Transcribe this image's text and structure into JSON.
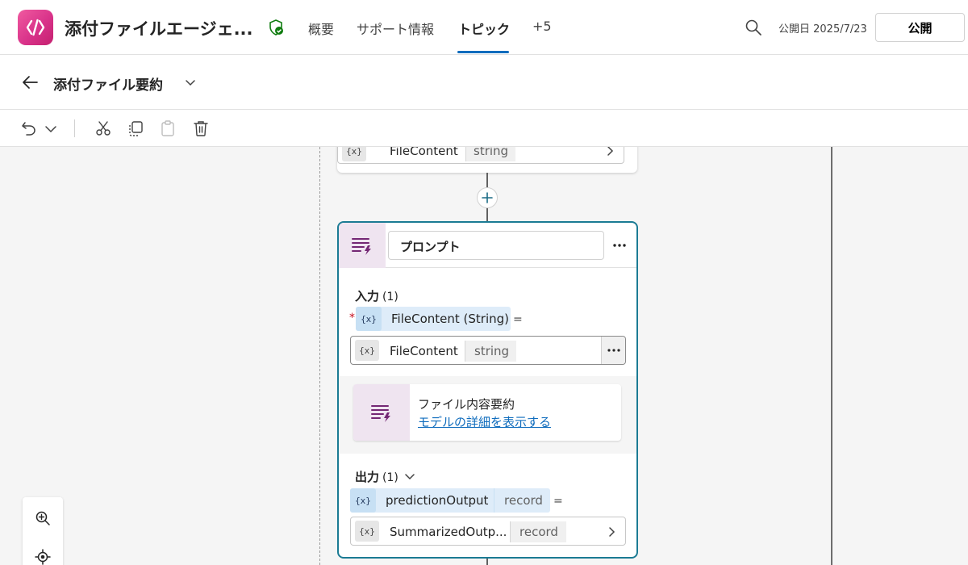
{
  "app": {
    "title": "添付ファイルエージェ...",
    "logo_icon": "code-app-icon",
    "status_icon": "shield-check-icon",
    "accent_color": "#0f6cbd",
    "logo_color": "#d9338a"
  },
  "nav": {
    "tabs": [
      {
        "label": "概要",
        "active": false
      },
      {
        "label": "サポート情報",
        "active": false
      },
      {
        "label": "トピック",
        "active": true
      },
      {
        "label": "+5",
        "active": false
      }
    ]
  },
  "header": {
    "published_date": "公開日 2025/7/23",
    "publish_label": "公開"
  },
  "topic": {
    "title": "添付ファイル要約"
  },
  "toolbar": {
    "icons": [
      "undo-icon",
      "chevron-down-icon",
      "cut-icon",
      "copy-icon",
      "paste-icon",
      "delete-icon"
    ]
  },
  "canvas": {
    "previous_node": {
      "var_icon": "{x}",
      "var_name": "FileContent",
      "var_type": "string"
    },
    "prompt_node": {
      "name": "プロンプト",
      "input_section": {
        "label": "入力",
        "count": "(1)"
      },
      "required_mark": "*",
      "input_param": {
        "icon": "{x}",
        "label": "FileContent (String)",
        "equals": "="
      },
      "input_value": {
        "icon": "{x}",
        "name": "FileContent",
        "type": "string"
      },
      "model": {
        "name": "ファイル内容要約",
        "link": "モデルの詳細を表示する"
      },
      "output_section": {
        "label": "出力",
        "count": "(1)"
      },
      "output_param": {
        "icon": "{x}",
        "name": "predictionOutput",
        "type": "record",
        "equals": "="
      },
      "output_value": {
        "icon": "{x}",
        "name": "SummarizedOutp...",
        "type": "record"
      },
      "border_color": "#1b7b94"
    },
    "zoom_controls": [
      "zoom-in-icon",
      "recenter-icon"
    ]
  }
}
